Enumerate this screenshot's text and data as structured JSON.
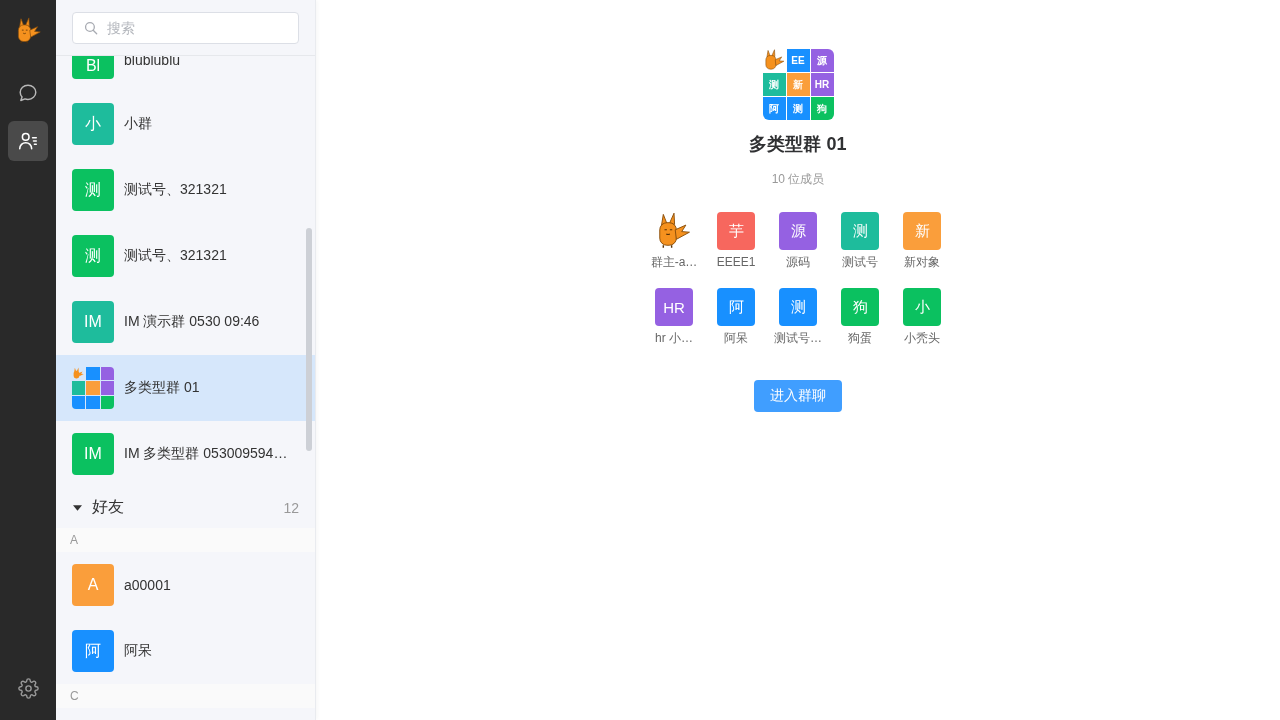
{
  "rail": {
    "nav": [
      {
        "kind": "chat",
        "selected": false
      },
      {
        "kind": "contacts",
        "selected": true
      }
    ]
  },
  "search": {
    "placeholder": "搜索"
  },
  "conversations": [
    {
      "kind": "initial",
      "avatar": "Bl",
      "color": "#0bc160",
      "name": "blublublu",
      "selected": false
    },
    {
      "kind": "initial",
      "avatar": "小",
      "color": "#1ebc9c",
      "name": "小群",
      "selected": false
    },
    {
      "kind": "initial",
      "avatar": "测",
      "color": "#0bc160",
      "name": "测试号、321321",
      "selected": false
    },
    {
      "kind": "initial",
      "avatar": "测",
      "color": "#0bc160",
      "name": "测试号、321321",
      "selected": false
    },
    {
      "kind": "initial",
      "avatar": "IM",
      "color": "#1ebc9c",
      "name": "IM 演示群 0530 09:46",
      "selected": false
    },
    {
      "kind": "grid",
      "tiles": [
        {
          "kind": "logo"
        },
        {
          "kind": "color",
          "color": "#1890ff"
        },
        {
          "kind": "color",
          "color": "#9561e2"
        },
        {
          "kind": "color",
          "color": "#1ebc9c"
        },
        {
          "kind": "color",
          "color": "#fa9e3b"
        },
        {
          "kind": "color",
          "color": "#9561e2"
        },
        {
          "kind": "color",
          "color": "#1890ff"
        },
        {
          "kind": "color",
          "color": "#1890ff"
        },
        {
          "kind": "color",
          "color": "#0bc160"
        }
      ],
      "name": "多类型群 01",
      "selected": true
    },
    {
      "kind": "initial",
      "avatar": "IM",
      "color": "#0bc160",
      "name": "IM 多类型群 053009594…",
      "selected": false
    }
  ],
  "friends": {
    "title": "好友",
    "count": "12",
    "expanded": true,
    "letters": [
      {
        "letter": "A",
        "contacts": [
          {
            "avatar": "A",
            "color": "#fa9e3b",
            "name": "a00001",
            "selected": false
          },
          {
            "avatar": "阿",
            "color": "#1890ff",
            "name": "阿呆",
            "selected": false
          }
        ]
      },
      {
        "letter": "C"
      }
    ]
  },
  "group": {
    "avatar_tiles": [
      {
        "kind": "logo"
      },
      {
        "kind": "text",
        "text": "EE",
        "color": "#1890ff"
      },
      {
        "kind": "text",
        "text": "源",
        "color": "#9561e2"
      },
      {
        "kind": "text",
        "text": "测",
        "color": "#1ebc9c"
      },
      {
        "kind": "text",
        "text": "新",
        "color": "#fa9e3b"
      },
      {
        "kind": "text",
        "text": "HR",
        "color": "#9561e2"
      },
      {
        "kind": "text",
        "text": "阿",
        "color": "#1890ff"
      },
      {
        "kind": "text",
        "text": "测",
        "color": "#1890ff"
      },
      {
        "kind": "text",
        "text": "狗",
        "color": "#0bc160"
      }
    ],
    "name": "多类型群 01",
    "member_count": "10 位成员",
    "members": [
      {
        "kind": "logo",
        "name": "群主-a…"
      },
      {
        "kind": "initial",
        "avatar": "芋",
        "color": "#f7675e",
        "name": "EEEE1"
      },
      {
        "kind": "initial",
        "avatar": "源",
        "color": "#9561e2",
        "name": "源码"
      },
      {
        "kind": "initial",
        "avatar": "测",
        "color": "#1ebc9c",
        "name": "测试号"
      },
      {
        "kind": "initial",
        "avatar": "新",
        "color": "#fa9e3b",
        "name": "新对象"
      },
      {
        "kind": "initial",
        "avatar": "HR",
        "color": "#9561e2",
        "name": "hr 小…"
      },
      {
        "kind": "initial",
        "avatar": "阿",
        "color": "#1890ff",
        "name": "阿呆"
      },
      {
        "kind": "initial",
        "avatar": "测",
        "color": "#1890ff",
        "name": "测试号…"
      },
      {
        "kind": "initial",
        "avatar": "狗",
        "color": "#0bc160",
        "name": "狗蛋"
      },
      {
        "kind": "initial",
        "avatar": "小",
        "color": "#0bc160",
        "name": "小秃头"
      }
    ],
    "enter_button": "进入群聊"
  }
}
